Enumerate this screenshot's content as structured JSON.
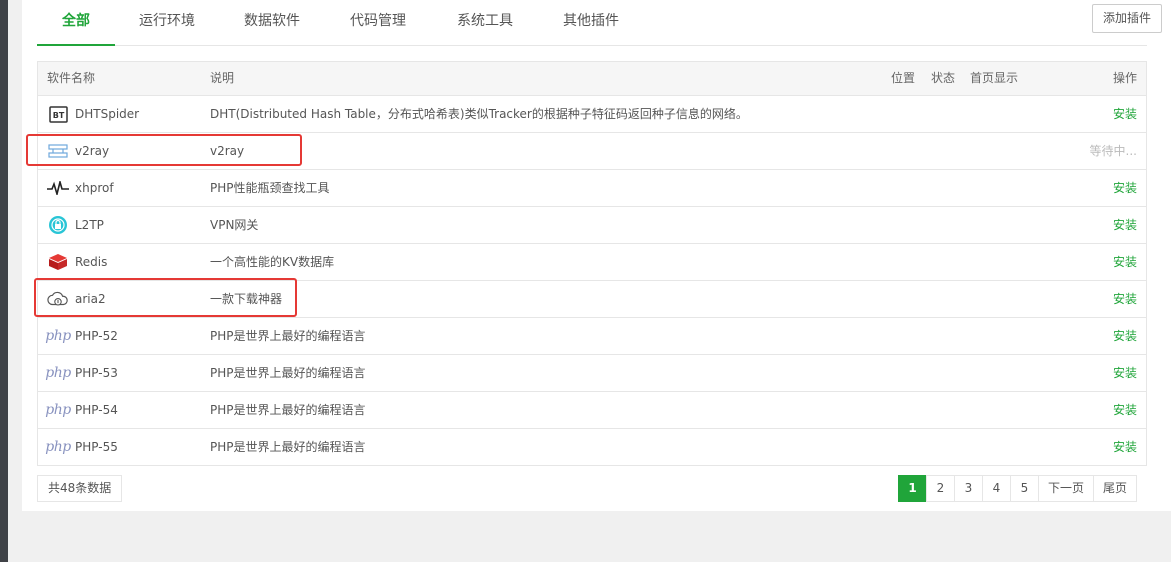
{
  "tabs": [
    {
      "label": "全部",
      "active": true
    },
    {
      "label": "运行环境"
    },
    {
      "label": "数据软件"
    },
    {
      "label": "代码管理"
    },
    {
      "label": "系统工具"
    },
    {
      "label": "其他插件"
    }
  ],
  "add_button": "添加插件",
  "table": {
    "headers": {
      "name": "软件名称",
      "desc": "说明",
      "position": "位置",
      "status": "状态",
      "homepage": "首页显示",
      "action": "操作"
    },
    "rows": [
      {
        "icon": "bt-icon",
        "name": "DHTSpider",
        "desc": "DHT(Distributed Hash Table，分布式哈希表)类似Tracker的根据种子特征码返回种子信息的网络。",
        "action": "安装"
      },
      {
        "icon": "v2ray-icon",
        "name": "v2ray",
        "desc": "v2ray",
        "action": "等待中..."
      },
      {
        "icon": "pulse-icon",
        "name": "xhprof",
        "desc": "PHP性能瓶颈查找工具",
        "action": "安装"
      },
      {
        "icon": "vpn-icon",
        "name": "L2TP",
        "desc": "VPN网关",
        "action": "安装"
      },
      {
        "icon": "redis-icon",
        "name": "Redis",
        "desc": "一个高性能的KV数据库",
        "action": "安装"
      },
      {
        "icon": "cloud-download-icon",
        "name": "aria2",
        "desc": "一款下载神器",
        "action": "安装"
      },
      {
        "icon": "php-icon",
        "name": "PHP-52",
        "desc": "PHP是世界上最好的编程语言",
        "action": "安装"
      },
      {
        "icon": "php-icon",
        "name": "PHP-53",
        "desc": "PHP是世界上最好的编程语言",
        "action": "安装"
      },
      {
        "icon": "php-icon",
        "name": "PHP-54",
        "desc": "PHP是世界上最好的编程语言",
        "action": "安装"
      },
      {
        "icon": "php-icon",
        "name": "PHP-55",
        "desc": "PHP是世界上最好的编程语言",
        "action": "安装"
      }
    ]
  },
  "php_icon_text": "php",
  "bt_icon_text": "BT",
  "total": "共48条数据",
  "pagination": {
    "pages": [
      "1",
      "2",
      "3",
      "4",
      "5"
    ],
    "current": "1",
    "next": "下一页",
    "last": "尾页"
  },
  "colors": {
    "accent": "#20a53a",
    "highlight": "#e53935",
    "waiting": "#bbbbbb"
  }
}
